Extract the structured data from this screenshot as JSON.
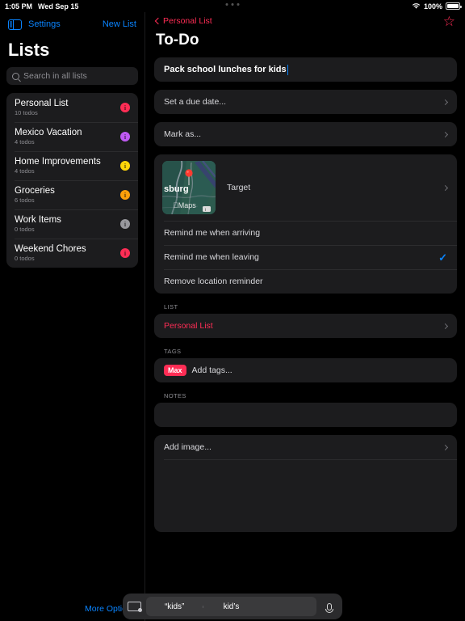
{
  "status_bar": {
    "time": "1:05 PM",
    "date": "Wed Sep 15",
    "battery_percent": "100%",
    "wifi_icon": "wifi-icon",
    "battery_icon": "battery-full-icon",
    "multitask_handle": "three-dots-handle"
  },
  "sidebar": {
    "toggle_icon": "sidebar-toggle-icon",
    "settings_label": "Settings",
    "new_list_label": "New List",
    "title": "Lists",
    "search": {
      "placeholder": "Search in all lists",
      "icon": "search-icon",
      "value": ""
    },
    "items": [
      {
        "name": "Personal List",
        "count": "10 todos",
        "badge_color": "#ff2d55",
        "badge_icon": "info-circle-icon"
      },
      {
        "name": "Mexico Vacation",
        "count": "4 todos",
        "badge_color": "#bf5af2",
        "badge_icon": "info-circle-icon"
      },
      {
        "name": "Home Improvements",
        "count": "4 todos",
        "badge_color": "#ffd60a",
        "badge_icon": "info-circle-icon"
      },
      {
        "name": "Groceries",
        "count": "6 todos",
        "badge_color": "#ff9f0a",
        "badge_icon": "info-circle-icon"
      },
      {
        "name": "Work Items",
        "count": "0 todos",
        "badge_color": "#98989d",
        "badge_icon": "info-circle-icon"
      },
      {
        "name": "Weekend Chores",
        "count": "0 todos",
        "badge_color": "#ff2d55",
        "badge_icon": "info-circle-icon"
      }
    ]
  },
  "detail": {
    "back_label": "Personal List",
    "back_icon": "chevron-left-icon",
    "favorite_icon": "star-outline-icon",
    "title": "To-Do",
    "todo_title_value": "Pack school lunches for kids",
    "due_date_label": "Set a due date...",
    "mark_as_label": "Mark as...",
    "location": {
      "map_icon": "map-thumbnail",
      "map_place_label": "sburg",
      "map_attribution": "Maps",
      "pin_icon": "map-pin-icon",
      "name": "Target",
      "options": [
        {
          "label": "Remind me when arriving",
          "checked": false
        },
        {
          "label": "Remind me when leaving",
          "checked": true
        },
        {
          "label": "Remove location reminder",
          "checked": false
        }
      ],
      "check_icon": "checkmark-icon",
      "check_color": "#0a84ff"
    },
    "list_section_header": "LIST",
    "list_value": "Personal List",
    "tags_section_header": "TAGS",
    "tag_chips": [
      "Max"
    ],
    "tags_placeholder": "Add tags...",
    "notes_section_header": "NOTES",
    "notes_value": "",
    "add_image_label": "Add image...",
    "accent_color": "#ff2d55"
  },
  "bottom_bar": {
    "more_options_label": "More Options",
    "keyboard_icon": "keyboard-hide-icon",
    "mic_icon": "microphone-icon",
    "predictions": [
      "“kids”",
      "kid’s",
      ""
    ]
  }
}
